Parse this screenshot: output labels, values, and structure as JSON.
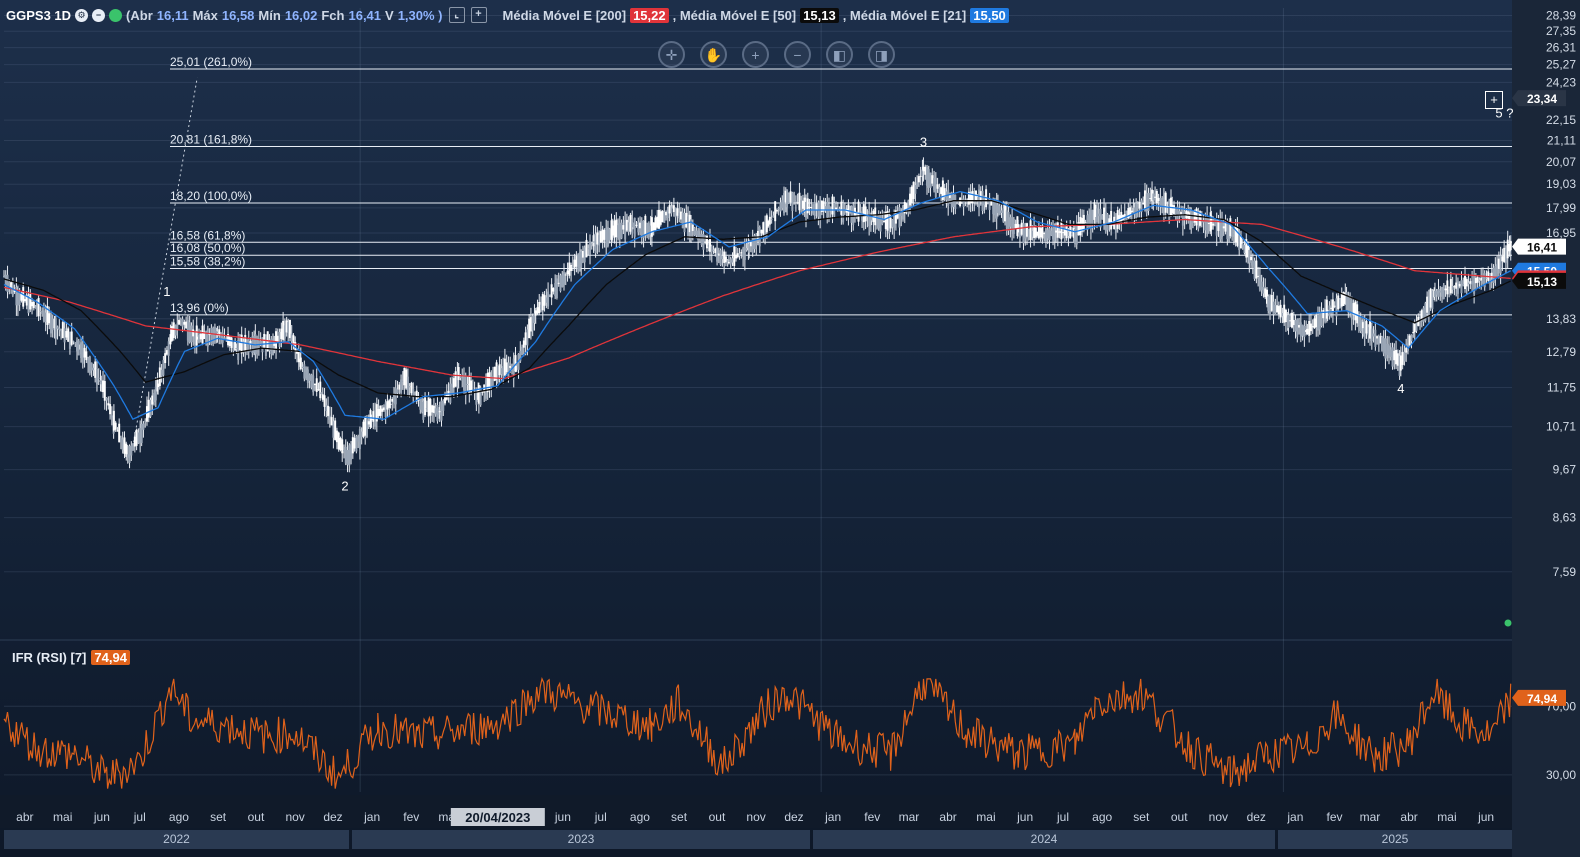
{
  "header": {
    "symbol": "GGPS3 1D",
    "abr_label": "(Abr",
    "abr_value": "16,11",
    "max_label": "Máx",
    "max_value": "16,58",
    "min_label": "Mín",
    "min_value": "16,02",
    "fch_label": "Fch",
    "fch_value": "16,41",
    "var_label": "V",
    "var_value": "1,30% )",
    "ma200_label": "Média Móvel E [200]",
    "ma200_value": "15,22",
    "ma50_label": ", Média Móvel E [50]",
    "ma50_value": "15,13",
    "ma21_label": ", Média Móvel E [21]",
    "ma21_value": "15,50"
  },
  "toolbar": [
    "crosshair-icon",
    "hand-icon",
    "zoom-in-icon",
    "zoom-out-icon",
    "scroll-left-icon",
    "scroll-right-icon"
  ],
  "colors": {
    "ma200": "#e0343a",
    "ma50": "#0b0b0b",
    "ma21": "#1f7ae0",
    "rsi": "#e0621b",
    "candle": "#e8ecf2",
    "fib": "#e8eef6"
  },
  "rsi": {
    "label": "IFR (RSI) [7]",
    "value": "74,94"
  },
  "price_axis_labels": [
    "28,39",
    "27,35",
    "26,31",
    "25,27",
    "24,23",
    "22,15",
    "21,11",
    "20,07",
    "19,03",
    "17,99",
    "16,95",
    "13,83",
    "12,79",
    "11,75",
    "10,71",
    "9,67",
    "8,63",
    "7,59"
  ],
  "price_badges": [
    {
      "value": "23,34",
      "kind": "crosshair"
    },
    {
      "value": "16,41",
      "kind": "last"
    },
    {
      "value": "15,50",
      "kind": "ma21"
    },
    {
      "value": "15,22",
      "kind": "ma200"
    },
    {
      "value": "15,13",
      "kind": "ma50"
    }
  ],
  "rsi_axis_labels": [
    "70,00",
    "30,00"
  ],
  "fib_levels": [
    {
      "price": 25.01,
      "label": "25,01 (261,0%)"
    },
    {
      "price": 20.81,
      "label": "20,81 (161,8%)"
    },
    {
      "price": 18.2,
      "label": "18,20 (100,0%)"
    },
    {
      "price": 16.58,
      "label": "16,58 (61,8%)"
    },
    {
      "price": 16.08,
      "label": "16,08 (50,0%)"
    },
    {
      "price": 15.58,
      "label": "15,58 (38,2%)"
    },
    {
      "price": 13.96,
      "label": "13,96 (0%)"
    }
  ],
  "wave_labels": [
    {
      "text": "1",
      "date": "2022-08-01",
      "price": 14.6
    },
    {
      "text": "2",
      "date": "2022-12-20",
      "price": 9.2
    },
    {
      "text": "3",
      "date": "2024-03-22",
      "price": 20.8
    },
    {
      "text": "4",
      "date": "2025-04-04",
      "price": 11.6
    },
    {
      "text": "5 ?",
      "date": "2025-06-25",
      "price": 22.3
    }
  ],
  "crosshair_date": "20/04/2023",
  "x_axis_months": [
    "abr",
    "mai",
    "jun",
    "jul",
    "ago",
    "set",
    "out",
    "nov",
    "dez",
    "jan",
    "fev",
    "ma",
    "jun",
    "jul",
    "ago",
    "set",
    "out",
    "nov",
    "dez",
    "jan",
    "fev",
    "mar",
    "abr",
    "mai",
    "jun",
    "jul",
    "ago",
    "set",
    "out",
    "nov",
    "dez",
    "jan",
    "fev",
    "mar",
    "abr",
    "mai",
    "jun"
  ],
  "x_axis_years": [
    "2022",
    "2023",
    "2024",
    "2025"
  ],
  "chart_data": {
    "type": "candlestick",
    "title": "GGPS3 1D",
    "x_range": [
      "2022-03-25",
      "2025-07-01"
    ],
    "ylim": [
      6.9,
      28.9
    ],
    "y_scale": "log",
    "grid": true,
    "series": [
      {
        "name": "GGPS3",
        "points": [
          [
            "2022-03-25",
            15.3
          ],
          [
            "2022-04-05",
            14.6
          ],
          [
            "2022-04-20",
            14.2
          ],
          [
            "2022-05-05",
            13.6
          ],
          [
            "2022-05-25",
            12.9
          ],
          [
            "2022-06-10",
            11.9
          ],
          [
            "2022-06-20",
            10.8
          ],
          [
            "2022-07-01",
            10.0
          ],
          [
            "2022-07-12",
            10.6
          ],
          [
            "2022-07-25",
            11.8
          ],
          [
            "2022-08-05",
            13.3
          ],
          [
            "2022-08-12",
            13.8
          ],
          [
            "2022-08-25",
            13.2
          ],
          [
            "2022-09-10",
            13.4
          ],
          [
            "2022-09-25",
            12.9
          ],
          [
            "2022-10-10",
            13.1
          ],
          [
            "2022-10-25",
            13.0
          ],
          [
            "2022-11-05",
            13.6
          ],
          [
            "2022-11-15",
            12.4
          ],
          [
            "2022-12-01",
            11.6
          ],
          [
            "2022-12-15",
            10.3
          ],
          [
            "2022-12-22",
            10.0
          ],
          [
            "2023-01-10",
            10.9
          ],
          [
            "2023-01-25",
            11.3
          ],
          [
            "2023-02-05",
            12.0
          ],
          [
            "2023-02-20",
            11.2
          ],
          [
            "2023-03-05",
            11.1
          ],
          [
            "2023-03-20",
            12.1
          ],
          [
            "2023-04-05",
            11.5
          ],
          [
            "2023-04-20",
            12.2
          ],
          [
            "2023-05-05",
            12.4
          ],
          [
            "2023-05-20",
            14.0
          ],
          [
            "2023-06-10",
            15.2
          ],
          [
            "2023-06-25",
            16.0
          ],
          [
            "2023-07-05",
            16.6
          ],
          [
            "2023-07-20",
            17.0
          ],
          [
            "2023-08-05",
            17.3
          ],
          [
            "2023-08-20",
            17.1
          ],
          [
            "2023-09-05",
            18.0
          ],
          [
            "2023-09-20",
            17.2
          ],
          [
            "2023-10-05",
            16.4
          ],
          [
            "2023-10-20",
            15.8
          ],
          [
            "2023-11-05",
            16.4
          ],
          [
            "2023-11-20",
            17.3
          ],
          [
            "2023-12-05",
            18.5
          ],
          [
            "2023-12-20",
            18.0
          ],
          [
            "2024-01-10",
            18.0
          ],
          [
            "2024-01-25",
            17.8
          ],
          [
            "2024-02-10",
            17.6
          ],
          [
            "2024-02-25",
            17.3
          ],
          [
            "2024-03-10",
            18.1
          ],
          [
            "2024-03-22",
            19.7
          ],
          [
            "2024-04-05",
            18.7
          ],
          [
            "2024-04-20",
            18.2
          ],
          [
            "2024-05-05",
            18.5
          ],
          [
            "2024-05-20",
            18.0
          ],
          [
            "2024-06-05",
            17.1
          ],
          [
            "2024-06-20",
            16.9
          ],
          [
            "2024-07-05",
            17.0
          ],
          [
            "2024-07-20",
            16.9
          ],
          [
            "2024-08-05",
            17.8
          ],
          [
            "2024-08-20",
            17.3
          ],
          [
            "2024-09-05",
            17.9
          ],
          [
            "2024-09-20",
            18.5
          ],
          [
            "2024-10-05",
            17.9
          ],
          [
            "2024-10-20",
            17.6
          ],
          [
            "2024-11-05",
            17.3
          ],
          [
            "2024-11-20",
            17.1
          ],
          [
            "2024-12-05",
            16.1
          ],
          [
            "2024-12-20",
            14.4
          ],
          [
            "2025-01-05",
            13.8
          ],
          [
            "2025-01-20",
            13.4
          ],
          [
            "2025-02-05",
            14.1
          ],
          [
            "2025-02-20",
            14.5
          ],
          [
            "2025-03-05",
            13.6
          ],
          [
            "2025-03-20",
            13.1
          ],
          [
            "2025-04-04",
            12.4
          ],
          [
            "2025-04-15",
            13.5
          ],
          [
            "2025-05-01",
            14.7
          ],
          [
            "2025-05-15",
            14.9
          ],
          [
            "2025-06-01",
            15.1
          ],
          [
            "2025-06-15",
            15.3
          ],
          [
            "2025-06-30",
            16.41
          ]
        ]
      },
      {
        "name": "Média Móvel E [21]",
        "points": [
          [
            "2022-03-25",
            15.0
          ],
          [
            "2022-04-20",
            14.4
          ],
          [
            "2022-05-20",
            13.5
          ],
          [
            "2022-06-20",
            11.8
          ],
          [
            "2022-07-05",
            10.9
          ],
          [
            "2022-07-25",
            11.2
          ],
          [
            "2022-08-15",
            12.8
          ],
          [
            "2022-09-10",
            13.2
          ],
          [
            "2022-10-10",
            13.0
          ],
          [
            "2022-11-05",
            13.1
          ],
          [
            "2022-11-25",
            12.5
          ],
          [
            "2022-12-20",
            11.0
          ],
          [
            "2023-01-20",
            10.9
          ],
          [
            "2023-02-20",
            11.5
          ],
          [
            "2023-03-20",
            11.6
          ],
          [
            "2023-04-20",
            11.8
          ],
          [
            "2023-05-20",
            13.1
          ],
          [
            "2023-06-20",
            15.0
          ],
          [
            "2023-07-20",
            16.3
          ],
          [
            "2023-08-20",
            17.0
          ],
          [
            "2023-09-20",
            17.4
          ],
          [
            "2023-10-20",
            16.4
          ],
          [
            "2023-11-20",
            16.8
          ],
          [
            "2023-12-20",
            17.9
          ],
          [
            "2024-01-20",
            17.9
          ],
          [
            "2024-02-20",
            17.5
          ],
          [
            "2024-03-20",
            18.2
          ],
          [
            "2024-04-20",
            18.7
          ],
          [
            "2024-05-20",
            18.3
          ],
          [
            "2024-06-20",
            17.4
          ],
          [
            "2024-07-20",
            17.0
          ],
          [
            "2024-08-20",
            17.4
          ],
          [
            "2024-09-20",
            18.1
          ],
          [
            "2024-10-20",
            17.9
          ],
          [
            "2024-11-20",
            17.3
          ],
          [
            "2024-12-20",
            15.6
          ],
          [
            "2025-01-20",
            14.0
          ],
          [
            "2025-02-20",
            14.1
          ],
          [
            "2025-03-20",
            13.6
          ],
          [
            "2025-04-10",
            12.9
          ],
          [
            "2025-05-05",
            14.1
          ],
          [
            "2025-06-05",
            14.9
          ],
          [
            "2025-06-30",
            15.5
          ]
        ]
      },
      {
        "name": "Média Móvel E [50]",
        "points": [
          [
            "2022-03-25",
            15.2
          ],
          [
            "2022-04-25",
            14.8
          ],
          [
            "2022-05-25",
            14.1
          ],
          [
            "2022-06-25",
            12.8
          ],
          [
            "2022-07-15",
            11.9
          ],
          [
            "2022-08-15",
            12.2
          ],
          [
            "2022-09-15",
            12.7
          ],
          [
            "2022-10-15",
            12.9
          ],
          [
            "2022-11-15",
            12.8
          ],
          [
            "2022-12-15",
            12.1
          ],
          [
            "2023-01-15",
            11.6
          ],
          [
            "2023-02-15",
            11.5
          ],
          [
            "2023-03-15",
            11.5
          ],
          [
            "2023-04-15",
            11.7
          ],
          [
            "2023-05-15",
            12.3
          ],
          [
            "2023-06-15",
            13.6
          ],
          [
            "2023-07-15",
            15.0
          ],
          [
            "2023-08-15",
            16.1
          ],
          [
            "2023-09-15",
            16.8
          ],
          [
            "2023-10-15",
            16.7
          ],
          [
            "2023-11-15",
            16.8
          ],
          [
            "2023-12-15",
            17.4
          ],
          [
            "2024-01-15",
            17.6
          ],
          [
            "2024-02-15",
            17.7
          ],
          [
            "2024-03-15",
            17.9
          ],
          [
            "2024-04-15",
            18.3
          ],
          [
            "2024-05-15",
            18.3
          ],
          [
            "2024-06-15",
            17.8
          ],
          [
            "2024-07-15",
            17.3
          ],
          [
            "2024-08-15",
            17.3
          ],
          [
            "2024-09-15",
            17.6
          ],
          [
            "2024-10-15",
            17.7
          ],
          [
            "2024-11-15",
            17.5
          ],
          [
            "2024-12-15",
            16.6
          ],
          [
            "2025-01-15",
            15.3
          ],
          [
            "2025-02-15",
            14.7
          ],
          [
            "2025-03-15",
            14.2
          ],
          [
            "2025-04-15",
            13.7
          ],
          [
            "2025-05-15",
            14.3
          ],
          [
            "2025-06-15",
            14.8
          ],
          [
            "2025-06-30",
            15.13
          ]
        ]
      },
      {
        "name": "Média Móvel E [200]",
        "points": [
          [
            "2022-03-25",
            14.9
          ],
          [
            "2022-05-15",
            14.4
          ],
          [
            "2022-07-15",
            13.6
          ],
          [
            "2022-09-15",
            13.3
          ],
          [
            "2022-11-15",
            13.0
          ],
          [
            "2023-01-15",
            12.5
          ],
          [
            "2023-03-15",
            12.1
          ],
          [
            "2023-04-25",
            12.0
          ],
          [
            "2023-06-15",
            12.6
          ],
          [
            "2023-08-15",
            13.6
          ],
          [
            "2023-10-15",
            14.6
          ],
          [
            "2023-12-15",
            15.5
          ],
          [
            "2024-02-15",
            16.2
          ],
          [
            "2024-04-15",
            16.8
          ],
          [
            "2024-06-15",
            17.2
          ],
          [
            "2024-08-15",
            17.3
          ],
          [
            "2024-10-15",
            17.5
          ],
          [
            "2024-12-15",
            17.3
          ],
          [
            "2025-02-15",
            16.4
          ],
          [
            "2025-04-15",
            15.5
          ],
          [
            "2025-06-30",
            15.22
          ]
        ]
      },
      {
        "name": "IFR (RSI) [7]",
        "points": [
          [
            "2022-03-25",
            62
          ],
          [
            "2022-04-20",
            45
          ],
          [
            "2022-05-20",
            42
          ],
          [
            "2022-06-15",
            28
          ],
          [
            "2022-07-10",
            38
          ],
          [
            "2022-08-05",
            82
          ],
          [
            "2022-08-20",
            62
          ],
          [
            "2022-09-20",
            58
          ],
          [
            "2022-10-20",
            52
          ],
          [
            "2022-11-10",
            55
          ],
          [
            "2022-12-15",
            28
          ],
          [
            "2023-01-15",
            58
          ],
          [
            "2023-02-15",
            52
          ],
          [
            "2023-03-15",
            55
          ],
          [
            "2023-04-20",
            60
          ],
          [
            "2023-05-25",
            80
          ],
          [
            "2023-06-20",
            72
          ],
          [
            "2023-07-20",
            65
          ],
          [
            "2023-08-20",
            58
          ],
          [
            "2023-09-10",
            72
          ],
          [
            "2023-10-15",
            35
          ],
          [
            "2023-11-20",
            70
          ],
          [
            "2023-12-05",
            78
          ],
          [
            "2024-01-15",
            50
          ],
          [
            "2024-02-25",
            42
          ],
          [
            "2024-03-22",
            85
          ],
          [
            "2024-04-25",
            55
          ],
          [
            "2024-06-05",
            42
          ],
          [
            "2024-07-20",
            48
          ],
          [
            "2024-08-05",
            72
          ],
          [
            "2024-09-10",
            78
          ],
          [
            "2024-10-20",
            45
          ],
          [
            "2024-11-20",
            30
          ],
          [
            "2024-12-20",
            42
          ],
          [
            "2025-01-20",
            45
          ],
          [
            "2025-02-10",
            65
          ],
          [
            "2025-03-15",
            40
          ],
          [
            "2025-04-10",
            48
          ],
          [
            "2025-04-30",
            78
          ],
          [
            "2025-05-20",
            60
          ],
          [
            "2025-06-15",
            52
          ],
          [
            "2025-06-30",
            74.94
          ]
        ]
      }
    ]
  }
}
